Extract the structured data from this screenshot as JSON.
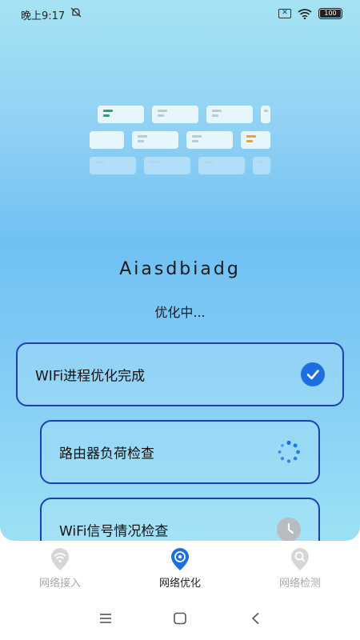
{
  "status_bar": {
    "time": "晚上9:17",
    "left_icon": "notification-muted-icon",
    "right_icons": [
      "sim-off-icon",
      "wifi-icon",
      "battery-icon"
    ],
    "battery_label": "100"
  },
  "app": {
    "title": "Aiasdbiadg",
    "status": "优化中..."
  },
  "tasks": [
    {
      "label": "WIFi进程优化完成",
      "state": "done",
      "icon": "check-circle-icon"
    },
    {
      "label": "路由器负荷检查",
      "state": "in-progress",
      "icon": "spinner-icon"
    },
    {
      "label": "WiFi信号情况检查",
      "state": "pending",
      "icon": "clock-icon"
    }
  ],
  "bottom_nav": {
    "items": [
      {
        "label": "网络接入",
        "icon": "wifi-icon",
        "active": false
      },
      {
        "label": "网络优化",
        "icon": "optimize-icon",
        "active": true
      },
      {
        "label": "网络检测",
        "icon": "search-icon",
        "active": false
      }
    ]
  },
  "system_nav": [
    "menu-icon",
    "home-icon",
    "back-icon"
  ],
  "colors": {
    "accent": "#1d6fe0",
    "border": "#1f3fb8",
    "inactive": "#b8bcc0"
  }
}
